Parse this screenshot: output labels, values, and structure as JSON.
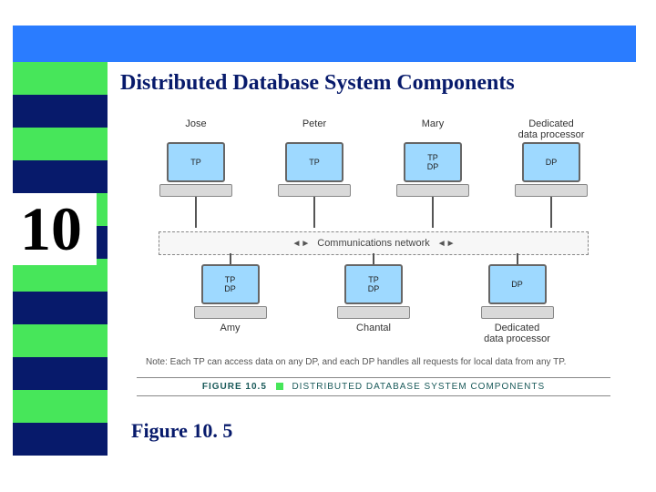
{
  "topbar": {
    "accent": "#2a7cff"
  },
  "sidebar": {
    "stripes": [
      "green",
      "navy",
      "green",
      "navy",
      "green",
      "navy",
      "green",
      "navy",
      "green",
      "navy",
      "green",
      "navy"
    ],
    "chapter_number": "10"
  },
  "title": "Distributed Database System Components",
  "caption": "Figure 10. 5",
  "figure": {
    "top_row": [
      {
        "label": "Jose",
        "screen": "TP"
      },
      {
        "label": "Peter",
        "screen": "TP"
      },
      {
        "label": "Mary",
        "screen": "TP\nDP"
      },
      {
        "label": "Dedicated\ndata processor",
        "screen": "DP"
      }
    ],
    "bottom_row": [
      {
        "label": "Amy",
        "screen": "TP\nDP"
      },
      {
        "label": "Chantal",
        "screen": "TP\nDP"
      },
      {
        "label": "Dedicated\ndata processor",
        "screen": "DP"
      }
    ],
    "network_label": "Communications network",
    "note": "Note:  Each TP can access data on any DP, and each DP handles all requests for local data from any TP.",
    "fig_label": "FIGURE 10.5",
    "fig_name": "DISTRIBUTED DATABASE SYSTEM COMPONENTS"
  }
}
